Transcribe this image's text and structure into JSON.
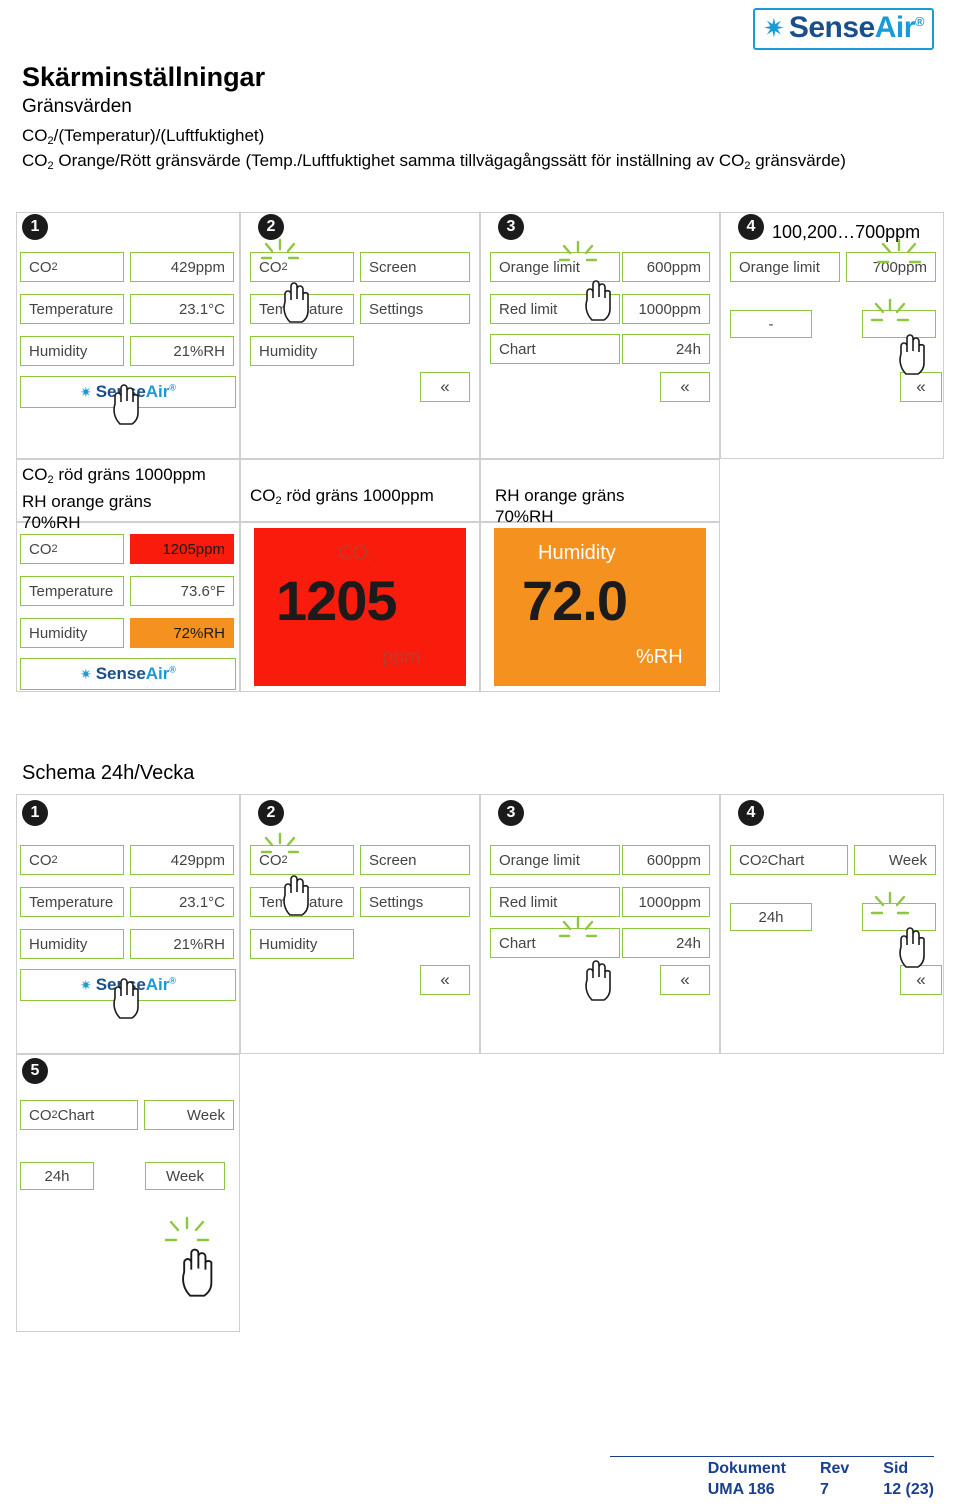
{
  "brand": {
    "name_light": "Sense",
    "name_dark": "Air",
    "registered": "®",
    "star": "✷"
  },
  "header": {
    "title": "Skärminställningar",
    "sub1": "Gränsvärden",
    "sub2": "CO2/(Temperatur)/(Luftfuktighet)",
    "paragraph": "CO2 Orange/Rött gränsvärde (Temp./Luftfuktighet samma tillvägagångssätt för inställning av CO2 gränsvärde)"
  },
  "steps": {
    "one": "❶",
    "two": "❷",
    "three": "❸",
    "four": "❹",
    "five": "❺",
    "n1": "1",
    "n2": "2",
    "n3": "3",
    "n4": "4",
    "n5": "5"
  },
  "section1": {
    "panel1": {
      "rows": [
        {
          "label": "CO2",
          "value": "429ppm"
        },
        {
          "label": "Temperature",
          "value": "23.1°C"
        },
        {
          "label": "Humidity",
          "value": "21%RH"
        }
      ]
    },
    "panel2": {
      "rows": [
        {
          "label": "CO2",
          "value": "Screen"
        },
        {
          "label": "Temperature",
          "value": "Settings"
        },
        {
          "label": "Humidity",
          "value": ""
        }
      ],
      "back": "«"
    },
    "panel3": {
      "rows": [
        {
          "label": "Orange limit",
          "value": "600ppm"
        },
        {
          "label": "Red limit",
          "value": "1000ppm"
        },
        {
          "label": "Chart",
          "value": "24h"
        }
      ],
      "back": "«"
    },
    "panel4": {
      "range": "100,200…700ppm",
      "label": "Orange limit",
      "value": "700ppm",
      "minus": "-",
      "back": "«"
    },
    "captions": {
      "c1": "CO2 röd gräns 1000ppm\nRH orange gräns\n70%RH",
      "c1_line1": "CO2 röd gräns 1000ppm",
      "c1_line2": "RH orange gräns",
      "c1_line3": "70%RH",
      "c2": "CO2 röd gräns 1000ppm",
      "c3_line1": "RH orange gräns",
      "c3_line2": "70%RH"
    },
    "result_panel": {
      "rows": [
        {
          "label": "CO2",
          "value": "1205ppm"
        },
        {
          "label": "Temperature",
          "value": "73.6°F"
        },
        {
          "label": "Humidity",
          "value": "72%RH"
        }
      ]
    },
    "tile_co2": {
      "label": "CO2",
      "big": "1205",
      "unit": "ppm"
    },
    "tile_rh": {
      "label": "Humidity",
      "big": "72.0",
      "unit": "%RH"
    }
  },
  "section2": {
    "title": "Schema 24h/Vecka",
    "panel1": {
      "rows": [
        {
          "label": "CO2",
          "value": "429ppm"
        },
        {
          "label": "Temperature",
          "value": "23.1°C"
        },
        {
          "label": "Humidity",
          "value": "21%RH"
        }
      ]
    },
    "panel2": {
      "rows": [
        {
          "label": "CO2",
          "value": "Screen"
        },
        {
          "label": "Temperature",
          "value": "Settings"
        },
        {
          "label": "Humidity",
          "value": ""
        }
      ],
      "back": "«"
    },
    "panel3": {
      "rows": [
        {
          "label": "Orange limit",
          "value": "600ppm"
        },
        {
          "label": "Red limit",
          "value": "1000ppm"
        },
        {
          "label": "Chart",
          "value": "24h"
        }
      ],
      "back": "«"
    },
    "panel4": {
      "label": "CO2 Chart",
      "value": "Week",
      "option": "24h",
      "back": "«"
    },
    "panel5": {
      "label": "CO2 Chart",
      "value": "Week",
      "option1": "24h",
      "option2": "Week"
    }
  },
  "footer": {
    "dokument_label": "Dokument",
    "dokument_value": "UMA 186",
    "rev_label": "Rev",
    "rev_value": "7",
    "sid_label": "Sid",
    "sid_value": "12 (23)"
  }
}
